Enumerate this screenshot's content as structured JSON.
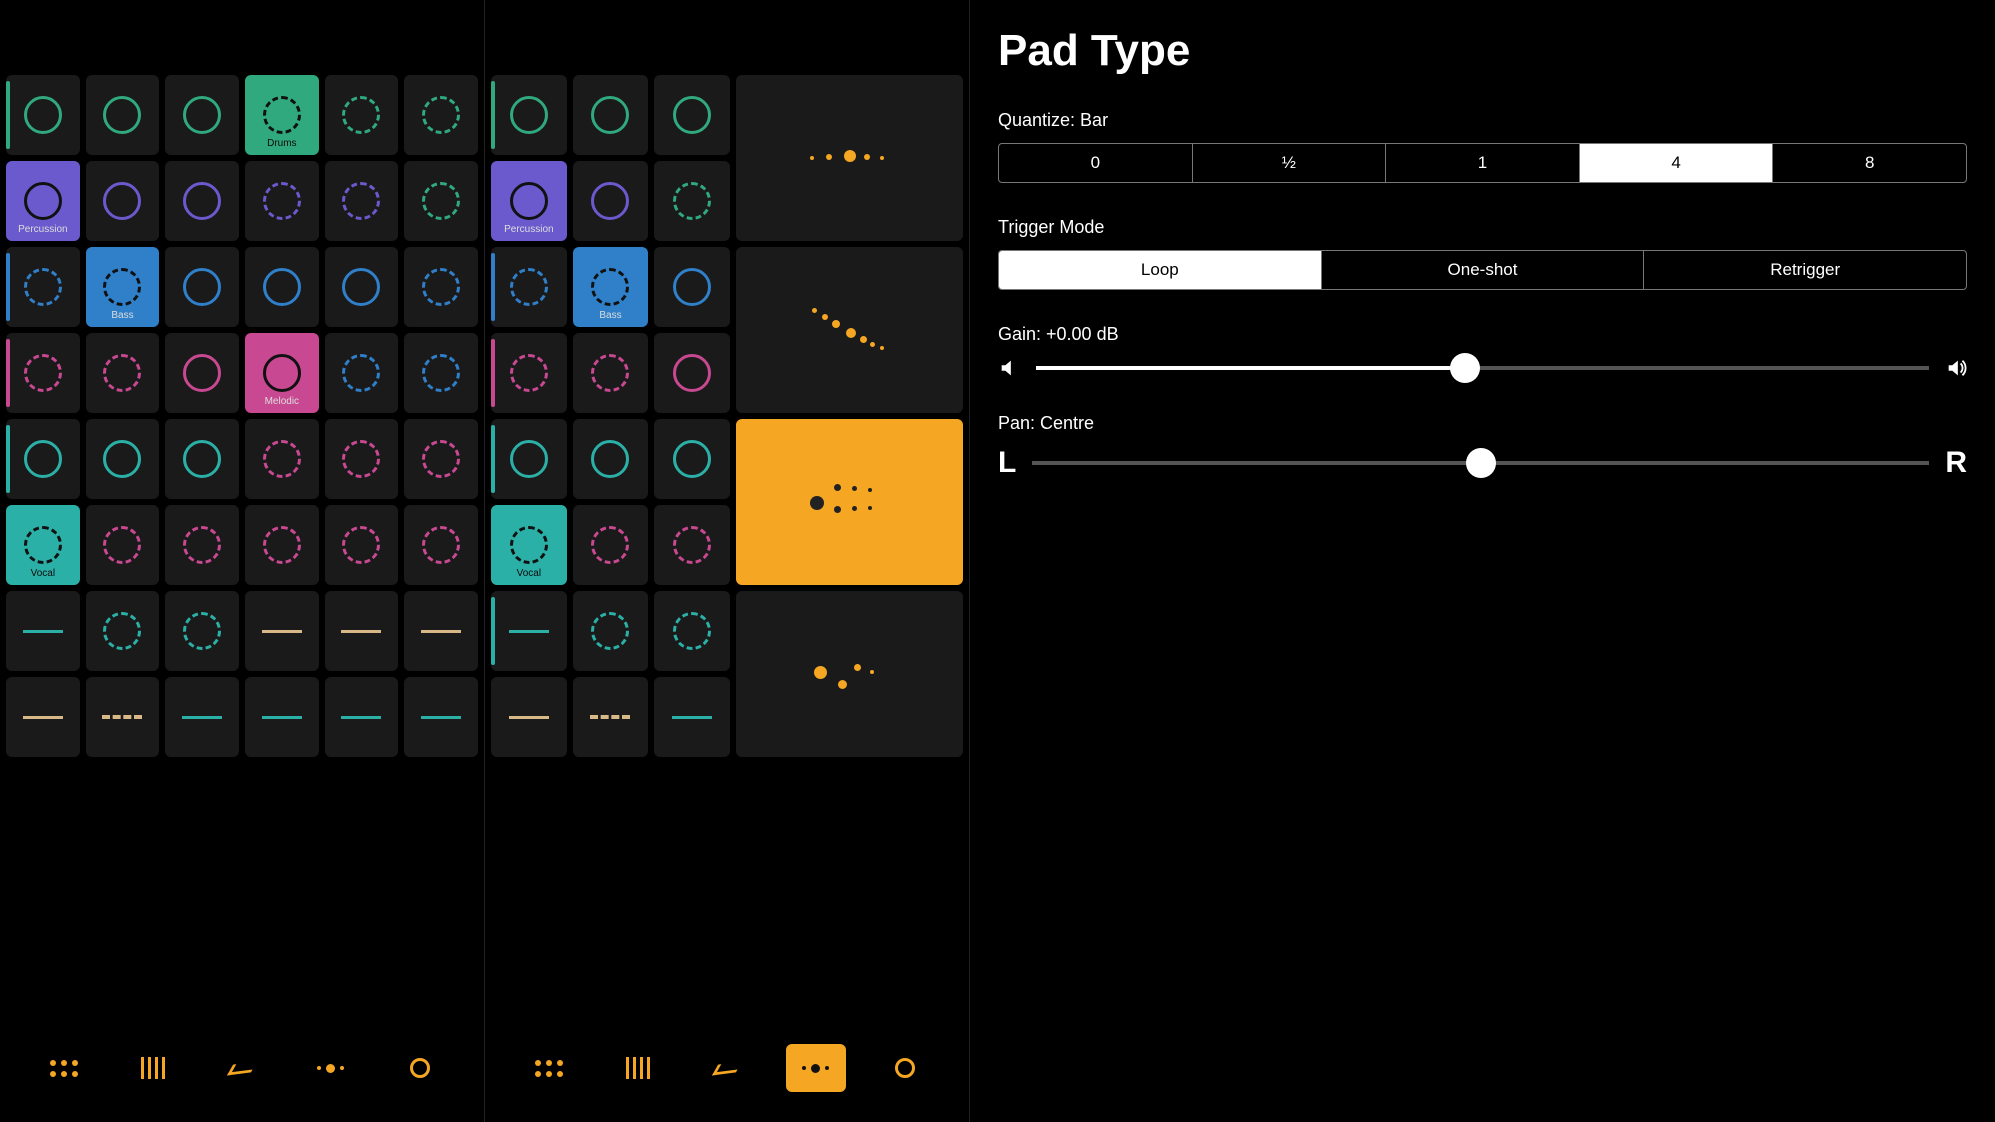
{
  "panel": {
    "title": "Pad Type",
    "quantize_label": "Quantize: Bar",
    "quantize_options": [
      "0",
      "½",
      "1",
      "4",
      "8"
    ],
    "quantize_selected": 3,
    "trigger_label": "Trigger Mode",
    "trigger_options": [
      "Loop",
      "One-shot",
      "Retrigger"
    ],
    "trigger_selected": 0,
    "gain_label": "Gain: +0.00 dB",
    "gain_value_pct": 48,
    "pan_label": "Pan: Centre",
    "pan_left": "L",
    "pan_right": "R",
    "pan_value_pct": 50
  },
  "left_grid": {
    "rows": [
      {
        "color": "green",
        "edge": "green",
        "cells": [
          {
            "style": "solid"
          },
          {
            "style": "solid"
          },
          {
            "style": "solid"
          },
          {
            "style": "dash",
            "bg": "green",
            "label": "Drums",
            "label_dark": true
          },
          {
            "style": "dash"
          },
          {
            "style": "dash"
          }
        ]
      },
      {
        "color": "purple",
        "edge": "purple",
        "cells": [
          {
            "style": "solid",
            "bg": "purple",
            "label": "Percussion"
          },
          {
            "style": "solid"
          },
          {
            "style": "solid"
          },
          {
            "style": "dash"
          },
          {
            "style": "dash"
          },
          {
            "style": "dash",
            "color": "green"
          }
        ]
      },
      {
        "color": "blue",
        "edge": "blue",
        "cells": [
          {
            "style": "dash"
          },
          {
            "style": "dash",
            "bg": "blue",
            "label": "Bass"
          },
          {
            "style": "solid"
          },
          {
            "style": "solid"
          },
          {
            "style": "solid"
          },
          {
            "style": "dash"
          }
        ]
      },
      {
        "color": "magenta",
        "edge": "magenta",
        "cells": [
          {
            "style": "dash"
          },
          {
            "style": "dash"
          },
          {
            "style": "solid"
          },
          {
            "style": "solid",
            "bg": "magenta",
            "label": "Melodic"
          },
          {
            "style": "dash",
            "color": "blue"
          },
          {
            "style": "dash",
            "color": "blue"
          }
        ]
      },
      {
        "color": "teal",
        "edge": "teal",
        "cells": [
          {
            "style": "solid"
          },
          {
            "style": "solid"
          },
          {
            "style": "solid"
          },
          {
            "style": "dash",
            "color": "magenta"
          },
          {
            "style": "dash",
            "color": "magenta"
          },
          {
            "style": "dash",
            "color": "magenta"
          }
        ]
      },
      {
        "color": "teal",
        "cells": [
          {
            "style": "dash",
            "bg": "teal",
            "label": "Vocal",
            "label_dark": true
          },
          {
            "style": "dash",
            "color": "magenta"
          },
          {
            "style": "dash",
            "color": "magenta"
          },
          {
            "style": "dash",
            "color": "magenta"
          },
          {
            "style": "dash",
            "color": "magenta"
          },
          {
            "style": "dash",
            "color": "magenta"
          }
        ]
      },
      {
        "color": "teal",
        "cells": [
          {
            "style": "line"
          },
          {
            "style": "dash"
          },
          {
            "style": "dash"
          },
          {
            "style": "line",
            "color": "tan"
          },
          {
            "style": "line",
            "color": "tan"
          },
          {
            "style": "line",
            "color": "tan"
          }
        ]
      },
      {
        "color": "teal",
        "cells": [
          {
            "style": "line",
            "color": "tan"
          },
          {
            "style": "dline",
            "color": "tan"
          },
          {
            "style": "line"
          },
          {
            "style": "line"
          },
          {
            "style": "line"
          },
          {
            "style": "line"
          }
        ]
      }
    ]
  },
  "mid_grid": {
    "rows": [
      {
        "edge": "green",
        "cells": [
          {
            "style": "solid",
            "color": "green"
          },
          {
            "style": "solid",
            "color": "green"
          },
          {
            "style": "solid",
            "color": "green"
          }
        ],
        "big": {
          "variant": "dots5",
          "tall": true
        }
      },
      {
        "edge": "purple",
        "cells": [
          {
            "style": "solid",
            "color": "purple",
            "bg": "purple",
            "label": "Percussion"
          },
          {
            "style": "solid",
            "color": "purple"
          },
          {
            "style": "dash",
            "color": "green"
          }
        ]
      },
      {
        "edge": "blue",
        "cells": [
          {
            "style": "dash",
            "color": "blue"
          },
          {
            "style": "dash",
            "color": "blue",
            "bg": "blue",
            "label": "Bass"
          },
          {
            "style": "solid",
            "color": "blue"
          }
        ],
        "big": {
          "variant": "diag",
          "tall": true
        }
      },
      {
        "edge": "magenta",
        "cells": [
          {
            "style": "dash",
            "color": "magenta"
          },
          {
            "style": "dash",
            "color": "magenta"
          },
          {
            "style": "solid",
            "color": "magenta"
          }
        ]
      },
      {
        "edge": "teal",
        "cells": [
          {
            "style": "solid",
            "color": "teal"
          },
          {
            "style": "solid",
            "color": "teal"
          },
          {
            "style": "solid",
            "color": "teal"
          }
        ],
        "big": {
          "variant": "cluster",
          "bg": "orange",
          "tall": true
        }
      },
      {
        "cells": [
          {
            "style": "dash",
            "color": "teal",
            "bg": "teal",
            "label": "Vocal",
            "label_dark": true
          },
          {
            "style": "dash",
            "color": "magenta"
          },
          {
            "style": "dash",
            "color": "magenta"
          }
        ]
      },
      {
        "edge": "teal",
        "cells": [
          {
            "style": "line",
            "color": "teal"
          },
          {
            "style": "dash",
            "color": "teal"
          },
          {
            "style": "dash",
            "color": "teal"
          }
        ],
        "big": {
          "variant": "trio",
          "tall": true
        }
      },
      {
        "cells": [
          {
            "style": "line",
            "color": "tan"
          },
          {
            "style": "dline",
            "color": "tan"
          },
          {
            "style": "line",
            "color": "teal"
          }
        ]
      }
    ]
  },
  "toolbar": {
    "items": [
      "grip",
      "bars",
      "chev",
      "dots",
      "circle"
    ],
    "left_active": -1,
    "mid_active": 3
  }
}
